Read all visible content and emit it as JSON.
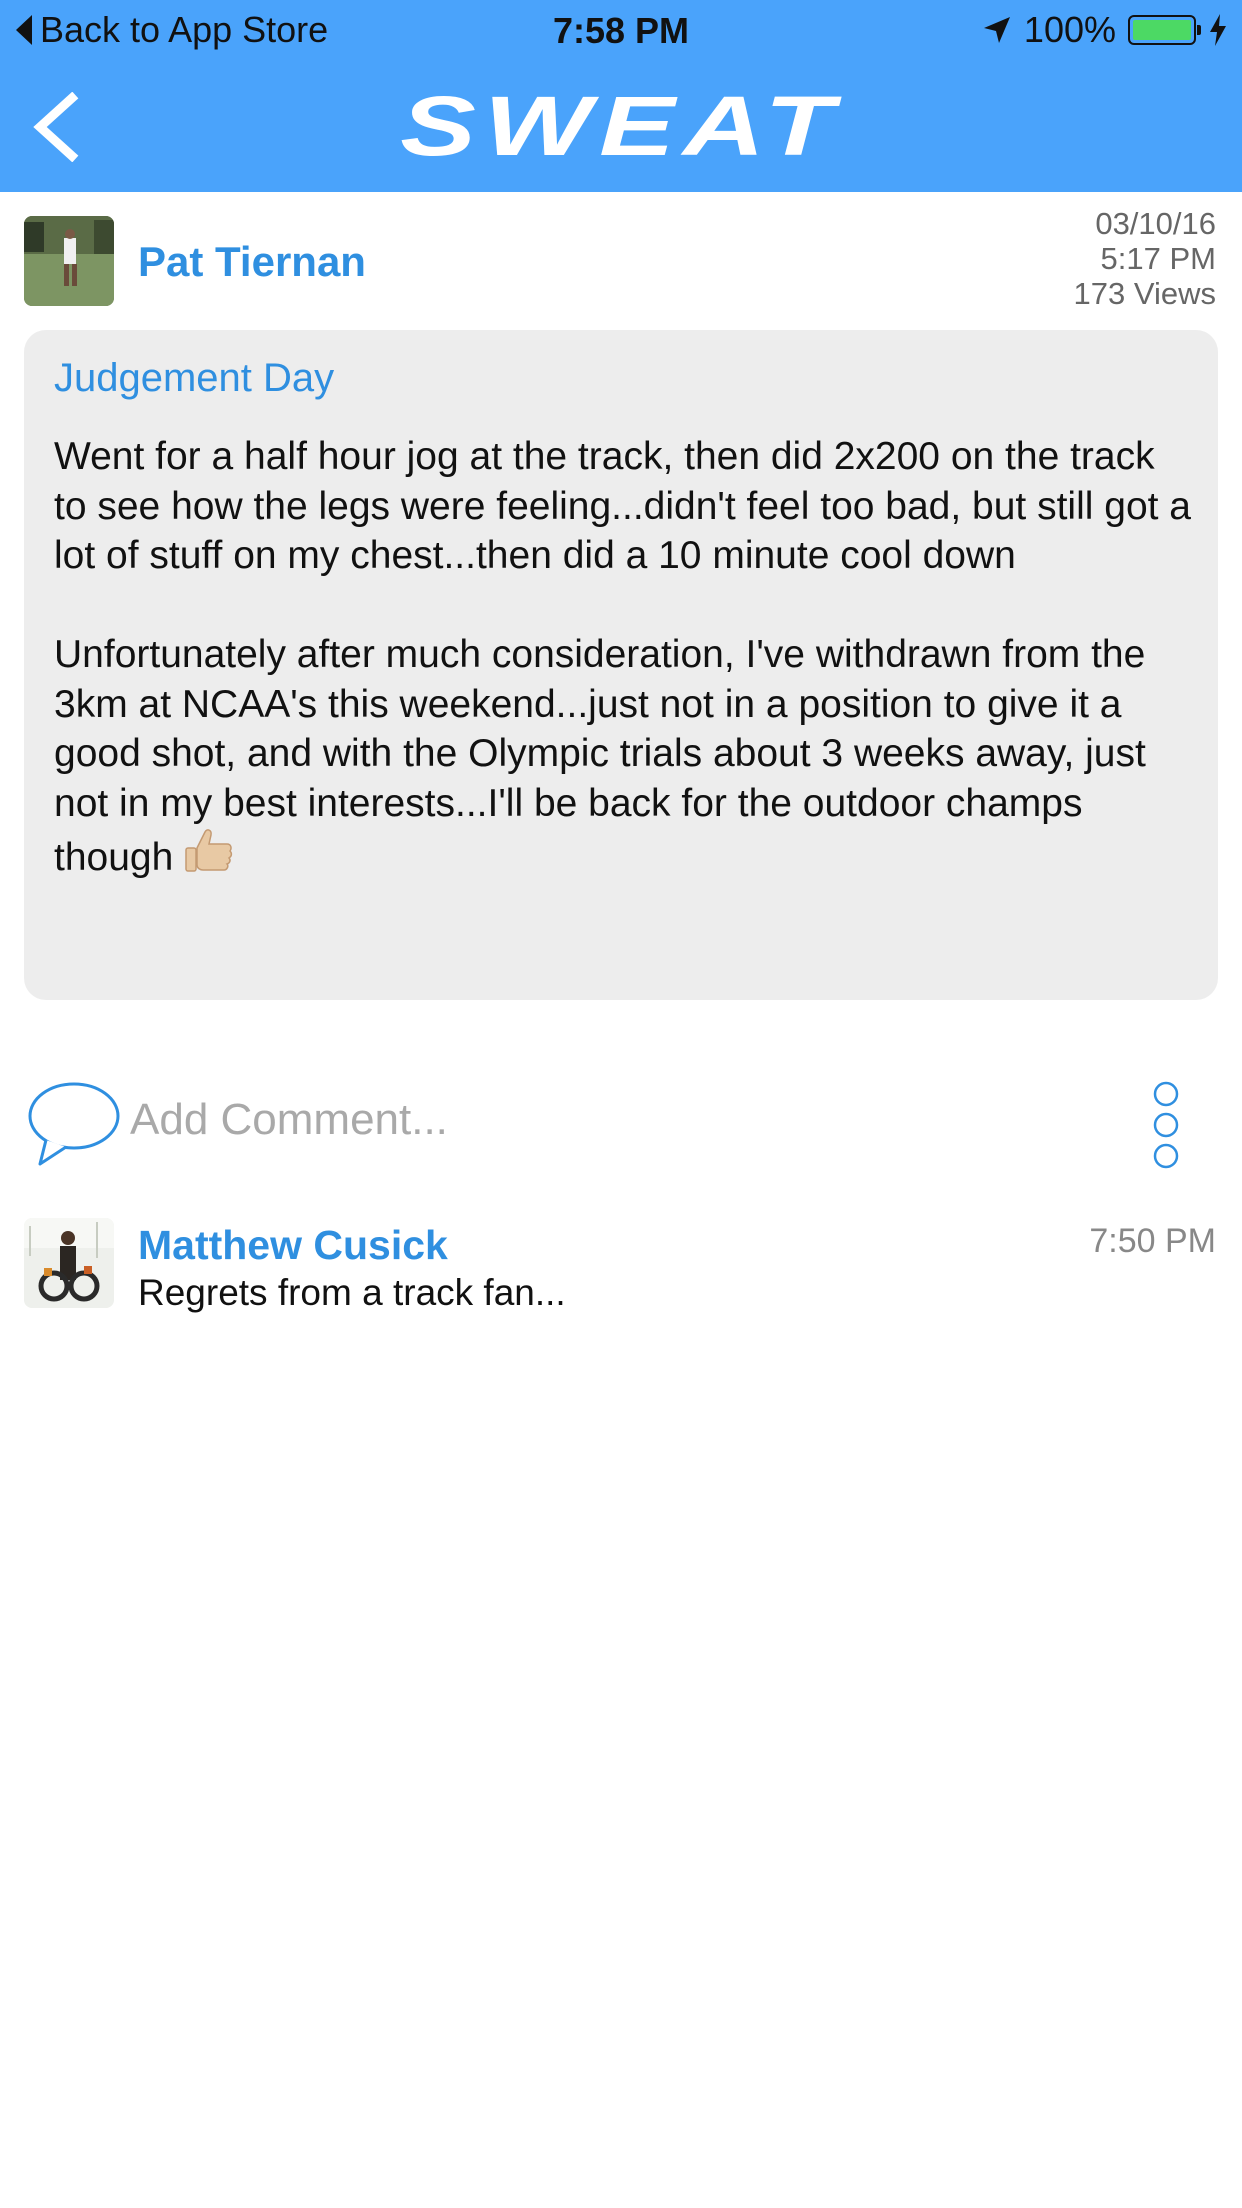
{
  "status_bar": {
    "back_label": "Back to App Store",
    "time": "7:58 PM",
    "battery_text": "100%",
    "battery_level": 1.0,
    "icons": [
      "location-arrow-icon",
      "battery-icon",
      "charging-bolt-icon"
    ]
  },
  "nav": {
    "back_icon": "chevron-left-icon",
    "brand": "SWEAT",
    "accent": "#4aa3fb"
  },
  "post": {
    "author": "Pat Tiernan",
    "date": "03/10/16",
    "time": "5:17 PM",
    "views": "173 Views",
    "title": "Judgement Day",
    "paragraph1": "Went for a half hour jog at the track, then did 2x200 on the track to see how the legs were feeling...didn't feel too bad, but still got a lot of stuff on my chest...then did a 10 minute cool down",
    "paragraph2": "Unfortunately after much consideration, I've withdrawn from the 3km at NCAA's this weekend...just not in a position to give it a good shot, and with the Olympic trials about 3 weeks away, just not in my best interests...I'll be back for the outdoor champs though",
    "emoji": "thumbs-up-icon"
  },
  "comment_bar": {
    "placeholder": "Add Comment...",
    "icons": [
      "speech-bubble-icon",
      "more-options-icon"
    ]
  },
  "comments": [
    {
      "author": "Matthew Cusick",
      "text": "Regrets from a track fan...",
      "time": "7:50 PM"
    }
  ],
  "colors": {
    "link_blue": "#2f8fe0",
    "card_gray": "#ededed"
  }
}
